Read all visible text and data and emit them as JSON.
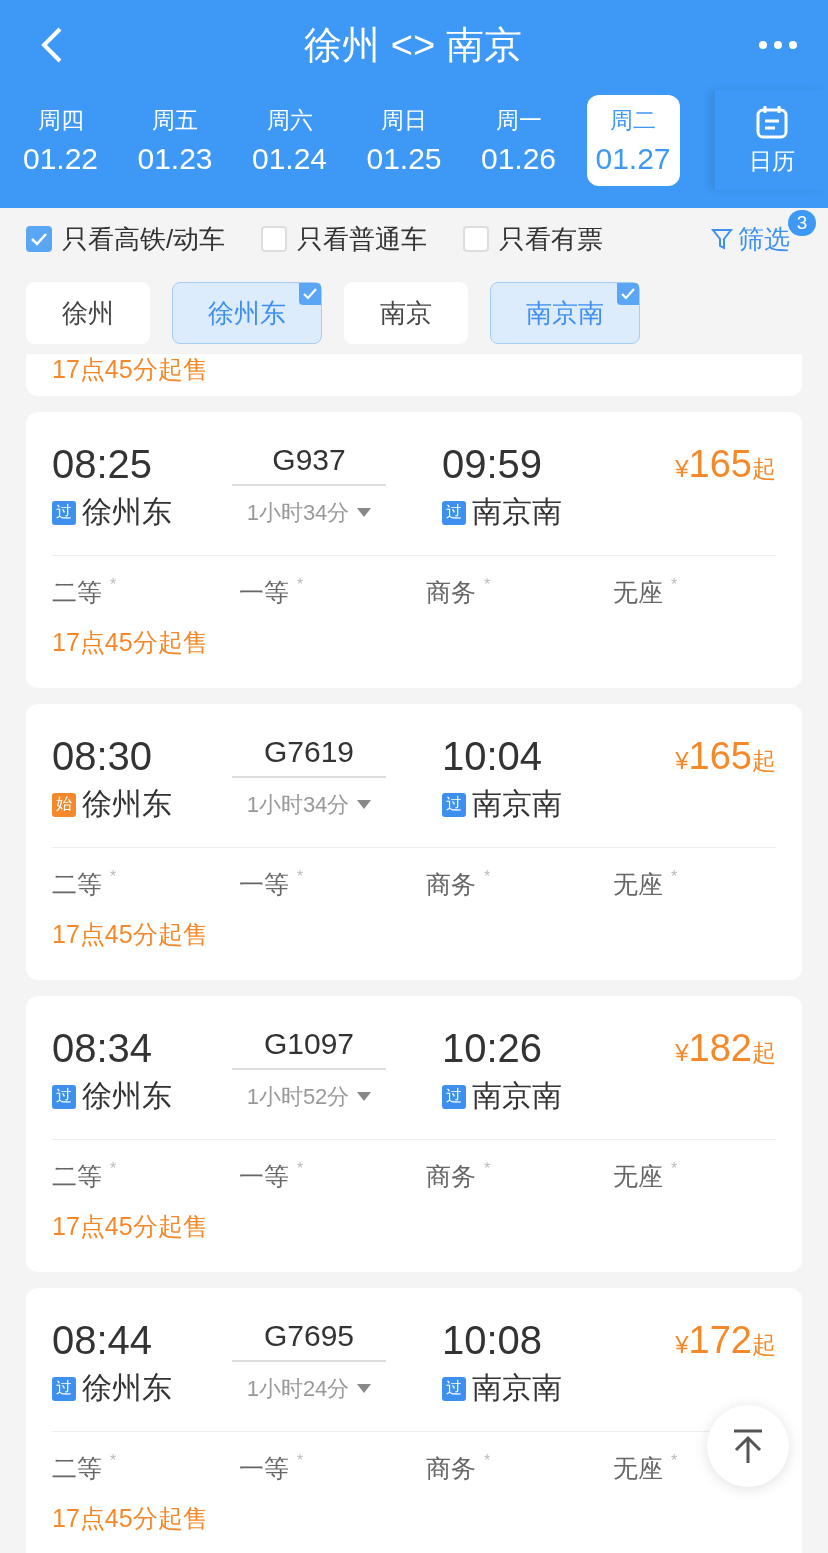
{
  "header": {
    "title": "徐州 <> 南京"
  },
  "dates": [
    {
      "weekday": "周四",
      "date": "01.22",
      "selected": false
    },
    {
      "weekday": "周五",
      "date": "01.23",
      "selected": false
    },
    {
      "weekday": "周六",
      "date": "01.24",
      "selected": false
    },
    {
      "weekday": "周日",
      "date": "01.25",
      "selected": false
    },
    {
      "weekday": "周一",
      "date": "01.26",
      "selected": false
    },
    {
      "weekday": "周二",
      "date": "01.27",
      "selected": true
    }
  ],
  "calendar": {
    "label": "日历"
  },
  "filters": [
    {
      "label": "只看高铁/动车",
      "checked": true
    },
    {
      "label": "只看普通车",
      "checked": false
    },
    {
      "label": "只看有票",
      "checked": false
    }
  ],
  "filter_button": {
    "label": "筛选",
    "badge": "3"
  },
  "stations": [
    {
      "label": "徐州",
      "selected": false
    },
    {
      "label": "徐州东",
      "selected": true
    },
    {
      "label": "南京",
      "selected": false
    },
    {
      "label": "南京南",
      "selected": true
    }
  ],
  "partial_card": {
    "sale": "17点45分起售"
  },
  "trains": [
    {
      "depart": "08:25",
      "number": "G937",
      "arrive": "09:59",
      "from_badge": {
        "text": "过",
        "color": "#3d8ff0"
      },
      "from": "徐州东",
      "duration": "1小时34分",
      "to_badge": {
        "text": "过",
        "color": "#3d8ff0"
      },
      "to": "南京南",
      "currency": "¥",
      "price": "165",
      "price_suffix": "起",
      "seats": [
        {
          "name": "二等",
          "avail": "*"
        },
        {
          "name": "一等",
          "avail": "*"
        },
        {
          "name": "商务",
          "avail": "*"
        },
        {
          "name": "无座",
          "avail": "*"
        }
      ],
      "sale": "17点45分起售"
    },
    {
      "depart": "08:30",
      "number": "G7619",
      "arrive": "10:04",
      "from_badge": {
        "text": "始",
        "color": "#f5892a"
      },
      "from": "徐州东",
      "duration": "1小时34分",
      "to_badge": {
        "text": "过",
        "color": "#3d8ff0"
      },
      "to": "南京南",
      "currency": "¥",
      "price": "165",
      "price_suffix": "起",
      "seats": [
        {
          "name": "二等",
          "avail": "*"
        },
        {
          "name": "一等",
          "avail": "*"
        },
        {
          "name": "商务",
          "avail": "*"
        },
        {
          "name": "无座",
          "avail": "*"
        }
      ],
      "sale": "17点45分起售"
    },
    {
      "depart": "08:34",
      "number": "G1097",
      "arrive": "10:26",
      "from_badge": {
        "text": "过",
        "color": "#3d8ff0"
      },
      "from": "徐州东",
      "duration": "1小时52分",
      "to_badge": {
        "text": "过",
        "color": "#3d8ff0"
      },
      "to": "南京南",
      "currency": "¥",
      "price": "182",
      "price_suffix": "起",
      "seats": [
        {
          "name": "二等",
          "avail": "*"
        },
        {
          "name": "一等",
          "avail": "*"
        },
        {
          "name": "商务",
          "avail": "*"
        },
        {
          "name": "无座",
          "avail": "*"
        }
      ],
      "sale": "17点45分起售"
    },
    {
      "depart": "08:44",
      "number": "G7695",
      "arrive": "10:08",
      "from_badge": {
        "text": "过",
        "color": "#3d8ff0"
      },
      "from": "徐州东",
      "duration": "1小时24分",
      "to_badge": {
        "text": "过",
        "color": "#3d8ff0"
      },
      "to": "南京南",
      "currency": "¥",
      "price": "172",
      "price_suffix": "起",
      "seats": [
        {
          "name": "二等",
          "avail": "*"
        },
        {
          "name": "一等",
          "avail": "*"
        },
        {
          "name": "商务",
          "avail": "*"
        },
        {
          "name": "无座",
          "avail": "*"
        }
      ],
      "sale": "17点45分起售"
    }
  ]
}
